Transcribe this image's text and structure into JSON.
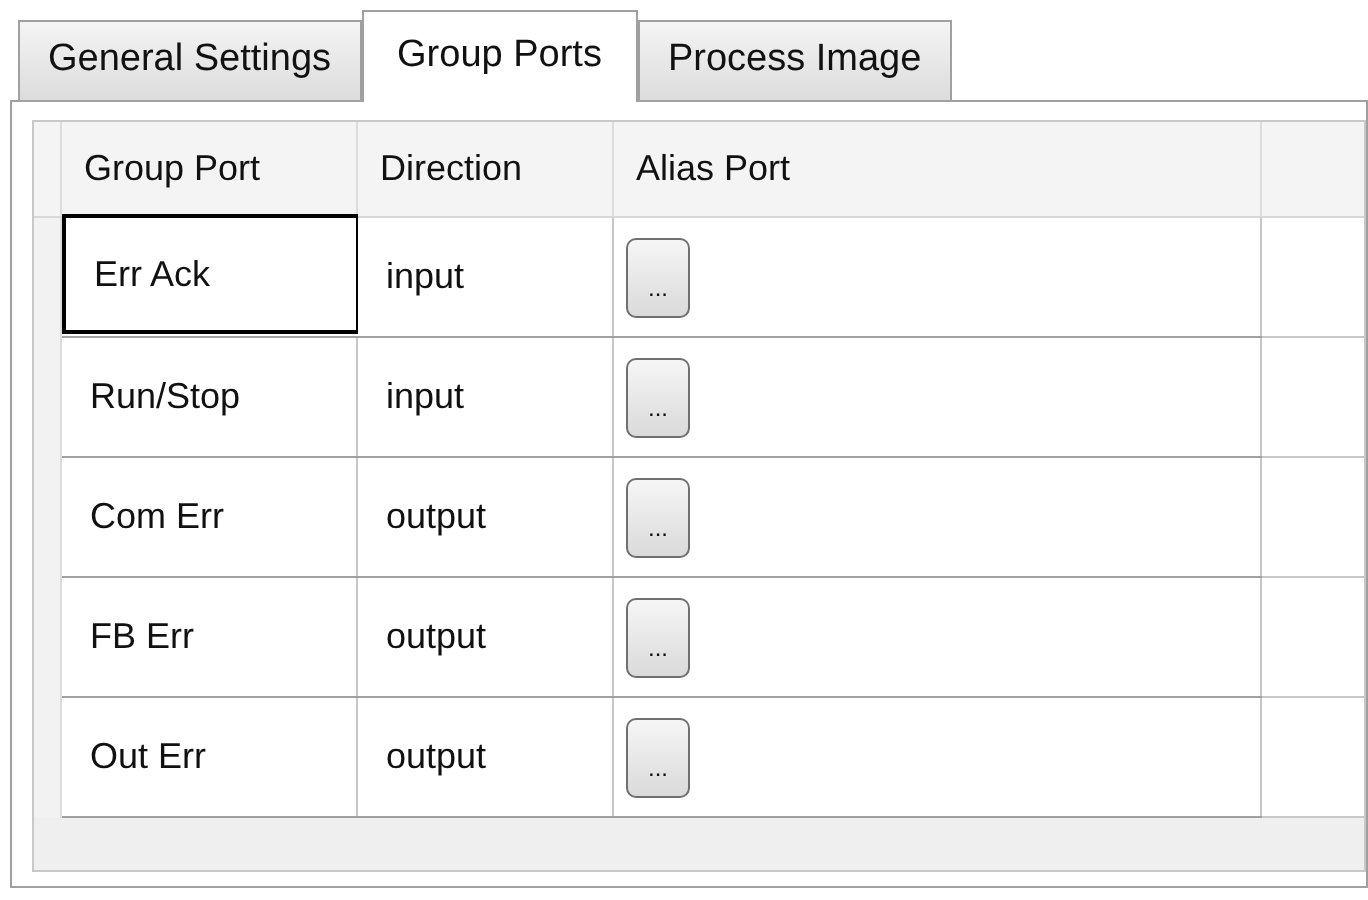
{
  "tabs": [
    {
      "label": "General Settings",
      "selected": false
    },
    {
      "label": "Group Ports",
      "selected": true
    },
    {
      "label": "Process Image",
      "selected": false
    }
  ],
  "table": {
    "columns": [
      "Group Port",
      "Direction",
      "Alias Port"
    ],
    "rows": [
      {
        "group_port": "Err Ack",
        "direction": "input",
        "alias_button": "...",
        "focused": true
      },
      {
        "group_port": "Run/Stop",
        "direction": "input",
        "alias_button": "...",
        "focused": false
      },
      {
        "group_port": "Com Err",
        "direction": "output",
        "alias_button": "...",
        "focused": false
      },
      {
        "group_port": "FB Err",
        "direction": "output",
        "alias_button": "...",
        "focused": false
      },
      {
        "group_port": "Out Err",
        "direction": "output",
        "alias_button": "...",
        "focused": false
      }
    ]
  }
}
